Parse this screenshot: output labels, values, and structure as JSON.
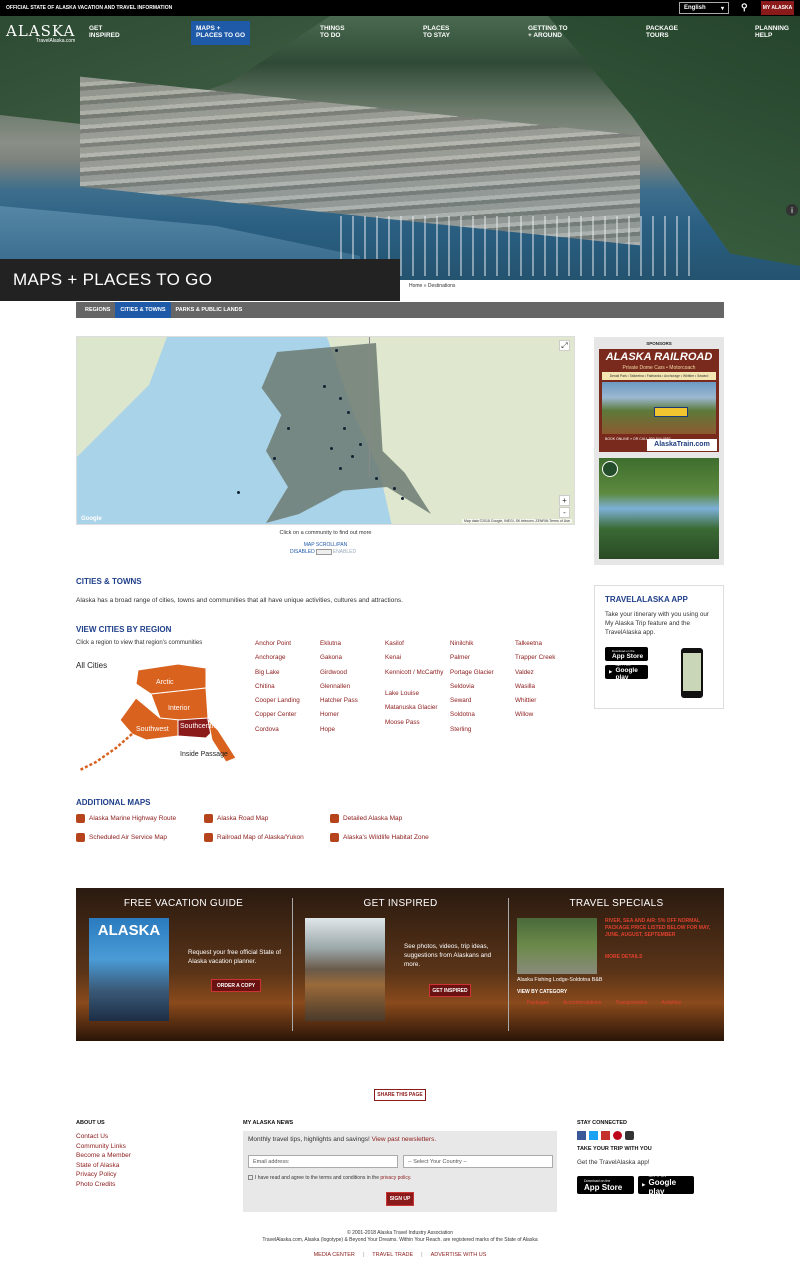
{
  "topbar": {
    "official": "OFFICIAL STATE OF ALASKA VACATION AND TRAVEL INFORMATION",
    "language": "English",
    "my_alaska": "MY ALASKA"
  },
  "logo": {
    "name": "ALASKA",
    "sub": "TravelAlaska.com"
  },
  "nav": [
    {
      "l1": "GET",
      "l2": "INSPIRED"
    },
    {
      "l1": "MAPS +",
      "l2": "PLACES TO GO"
    },
    {
      "l1": "THINGS",
      "l2": "TO DO"
    },
    {
      "l1": "PLACES",
      "l2": "TO STAY"
    },
    {
      "l1": "GETTING TO",
      "l2": "+ AROUND"
    },
    {
      "l1": "PACKAGE",
      "l2": "TOURS"
    },
    {
      "l1": "PLANNING",
      "l2": "HELP"
    }
  ],
  "page_title": "MAPS + PLACES TO GO",
  "breadcrumb": {
    "home": "Home",
    "sep": "»",
    "current": "Destinations"
  },
  "subnav": [
    "REGIONS",
    "CITIES & TOWNS",
    "PARKS & PUBLIC LANDS"
  ],
  "map": {
    "google": "Google",
    "attribution": "Map data ©2018 Google, INEGI, SK telecom, ZENRIN    Terms of Use",
    "zoom_in": "+",
    "zoom_out": "-",
    "click_hint": "Click on a community to find out more",
    "scroll_label": "MAP SCROLL/PAN",
    "disabled": "DISABLED",
    "enabled": "ENABLED"
  },
  "cities_section": {
    "heading": "CITIES & TOWNS",
    "desc": "Alaska has a broad range of cities, towns and communities that all have unique activities, cultures and attractions."
  },
  "region_section": {
    "heading": "VIEW CITIES BY REGION",
    "desc": "Click a region to view that region's communities",
    "all": "All Cities",
    "regions": [
      "Arctic",
      "Interior",
      "Southwest",
      "Southcentral",
      "Inside Passage"
    ]
  },
  "cities": [
    [
      "Anchor Point",
      "Anchorage",
      "Big Lake",
      "Chitina",
      "Cooper Landing",
      "Copper Center",
      "Cordova"
    ],
    [
      "Eklutna",
      "Gakona",
      "Girdwood",
      "Glennallen",
      "Hatcher Pass",
      "Homer",
      "Hope"
    ],
    [
      "Kasilof",
      "Kenai",
      "Kennicott / McCarthy",
      "Lake Louise",
      "Matanuska Glacier",
      "Moose Pass"
    ],
    [
      "Ninilchik",
      "Palmer",
      "Portage Glacier",
      "Seldovia",
      "Seward",
      "Soldotna",
      "Sterling"
    ],
    [
      "Talkeetna",
      "Trapper Creek",
      "Valdez",
      "Wasilla",
      "Whittier",
      "Willow"
    ]
  ],
  "additional_maps": {
    "heading": "ADDITIONAL MAPS",
    "items": [
      "Alaska Marine Highway Route",
      "Alaska Road Map",
      "Detailed Alaska Map",
      "Scheduled Air Service Map",
      "Railroad Map of Alaska/Yukon",
      "Alaska's Wildlife Habitat Zone"
    ]
  },
  "sponsors": {
    "label": "SPONSORS",
    "ad_title": "ALASKA RAILROAD",
    "ad_sub": "Private Dome Cars • Motorcoach",
    "ad_band": "Denali Park • Talkeetna • Fairbanks • Anchorage • Whittier • Seward",
    "ad_book": "BOOK ONLINE » OR CALL 800-544-0552",
    "ad_web": "AlaskaTrain.com"
  },
  "app": {
    "heading": "TRAVELALASKA APP",
    "text": "Take your itinerary with you using our My Alaska Trip feature and the TravelAlaska app.",
    "appstore_small": "Download on the",
    "appstore": "App Store",
    "gplay_small": "GET IT ON",
    "gplay": "Google play"
  },
  "promo": {
    "guide": {
      "title": "FREE VACATION GUIDE",
      "cover": "ALASKA",
      "text": "Request your free official State of Alaska vacation planner.",
      "button": "ORDER A COPY"
    },
    "inspired": {
      "title": "GET INSPIRED",
      "text": "See photos, videos, trip ideas, suggestions from Alaskans and more.",
      "button": "GET INSPIRED"
    },
    "specials": {
      "title": "TRAVEL SPECIALS",
      "deal": "RIVER, SEA AND AIR: 5% OFF NORMAL PACKAGE PRICE LISTED BELOW FOR MAY, JUNE, AUGUST, SEPTEMBER",
      "lodge": "Alaska Fishing Lodge-Soldotna B&B",
      "more": "MORE DETAILS",
      "by_cat": "VIEW BY CATEGORY",
      "cats": [
        "Packages",
        "Accommodations",
        "Transportation",
        "Activities"
      ]
    }
  },
  "share": "SHARE THIS PAGE",
  "footer": {
    "about_head": "ABOUT US",
    "about_links": [
      "Contact Us",
      "Community Links",
      "Become a Member",
      "State of Alaska",
      "Privacy Policy",
      "Photo Credits"
    ],
    "news_head": "MY ALASKA NEWS",
    "news_text": "Monthly travel tips, highlights and savings!",
    "news_link": "View past newsletters.",
    "email_ph": "Email address:",
    "country_ph": "-- Select Your Country --",
    "agree": "I have read and agree to the terms and conditions in the",
    "agree_link": "privacy policy.",
    "signup": "SIGN UP",
    "stay_head": "STAY CONNECTED",
    "take_head": "TAKE YOUR TRIP WITH YOU",
    "get_app": "Get the TravelAlaska app!",
    "copyright": "© 2001-2018 Alaska Travel Industry Association",
    "marks": "TravelAlaska.com, Alaska (logotype) & Beyond Your Dreams. Within Your Reach. are registered marks of the State of Alaska",
    "links": [
      "MEDIA CENTER",
      "TRAVEL TRADE",
      "ADVERTISE WITH US"
    ]
  }
}
